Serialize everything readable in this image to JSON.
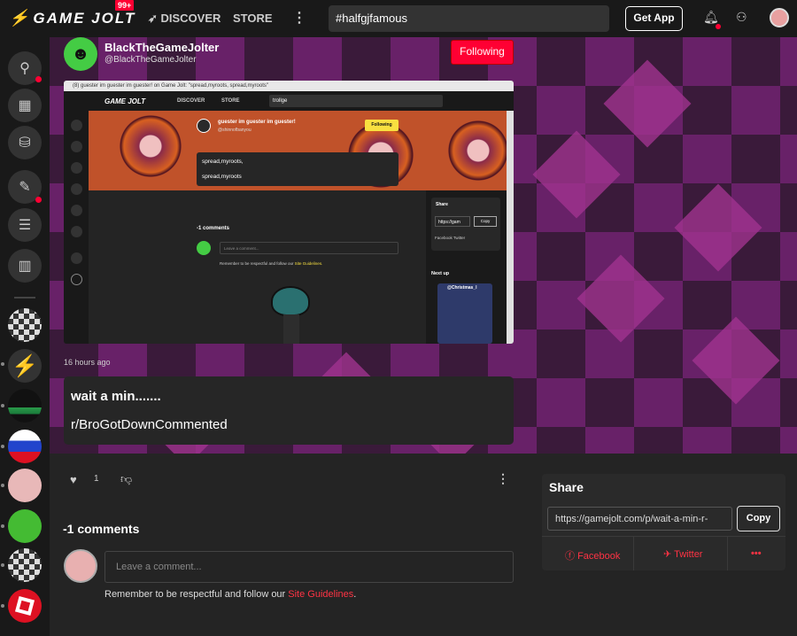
{
  "topbar": {
    "logo": "GAME JOLT",
    "notif_count": "99+",
    "nav": {
      "discover": "DISCOVER",
      "store": "STORE",
      "more": "⋮"
    },
    "search_value": "#halfgjfamous",
    "get_app": "Get App"
  },
  "post": {
    "author_name": "BlackTheGameJolter",
    "author_handle": "@BlackTheGameJolter",
    "follow_label": "Following",
    "time": "16 hours ago",
    "body_line1": "wait a min.......",
    "body_line2": "r/BroGotDownCommented",
    "like_count": "1"
  },
  "screenshot": {
    "titlebar": "(8) guester im guester im guester! on Game Jolt: \"spread,myroots, spread,myroots\"",
    "logo": "GAME JOLT",
    "nav_discover": "DISCOVER",
    "nav_store": "STORE",
    "search": "trollge",
    "author": "guester im guester im guester!",
    "handle": "@shinnofbanyou",
    "follow": "Following",
    "line1": "spread,myroots,",
    "line2": "spread,myroots",
    "comments": "-1 comments",
    "comment_placeholder": "Leave a comment...",
    "guide_text": "Remember to be respectful and follow our ",
    "guide_link": "Site Guidelines.",
    "share_title": "Share",
    "share_url": "https://gam",
    "share_copy": "Copy",
    "share_social": "Facebook  Twitter",
    "next_up": "Next up",
    "card_title": "@Christmas_l"
  },
  "comments": {
    "header": "-1 comments",
    "placeholder": "Leave a comment...",
    "guide_text": "Remember to be respectful and follow our ",
    "guide_link": "Site Guidelines",
    "guide_end": "."
  },
  "share": {
    "title": "Share",
    "url": "https://gamejolt.com/p/wait-a-min-r-",
    "copy": "Copy",
    "facebook": "Facebook",
    "twitter": "Twitter",
    "more": "•••"
  },
  "colors": {
    "accent": "#ff0033",
    "background": "#1e1e1e"
  }
}
